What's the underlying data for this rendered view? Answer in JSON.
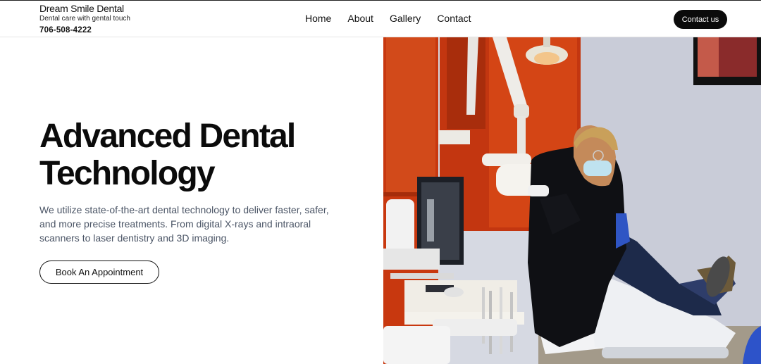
{
  "brand": {
    "name": "Dream Smile Dental",
    "tagline": "Dental care with gental touch",
    "phone": "706-508-4222"
  },
  "nav": {
    "items": [
      "Home",
      "About",
      "Gallery",
      "Contact"
    ]
  },
  "header": {
    "cta_label": "Contact us"
  },
  "hero": {
    "title_line1": "Advanced Dental",
    "title_line2": "Technology",
    "description": "We utilize state-of-the-art dental technology to deliver faster, safer, and more precise treatments. From digital X-rays and intraoral scanners to laser dentistry and 3D imaging.",
    "button_label": "Book An Appointment",
    "image_icon": "dental-treatment-photo"
  },
  "colors": {
    "accent": "#0b0b0b",
    "text_muted": "#4b5566",
    "cabinet_red": "#c8380f",
    "chair_blue": "#2a3f8f"
  }
}
